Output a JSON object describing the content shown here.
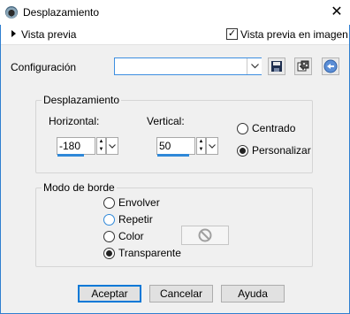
{
  "window": {
    "title": "Desplazamiento",
    "close_icon": "close-icon"
  },
  "preview": {
    "label": "Vista previa",
    "live_label": "Vista previa en imagen",
    "live_checked": true
  },
  "config": {
    "label": "Configuración",
    "value": ""
  },
  "offset_group": {
    "title": "Desplazamiento",
    "horizontal_label": "Horizontal:",
    "horizontal_value": "-180",
    "vertical_label": "Vertical:",
    "vertical_value": "50",
    "options": [
      {
        "label": "Centrado",
        "selected": false
      },
      {
        "label": "Personalizar",
        "selected": true
      }
    ]
  },
  "border_group": {
    "title": "Modo de borde",
    "options": [
      {
        "label": "Envolver",
        "selected": false
      },
      {
        "label": "Repetir",
        "selected": false
      },
      {
        "label": "Color",
        "selected": false
      },
      {
        "label": "Transparente",
        "selected": true
      }
    ]
  },
  "buttons": {
    "ok": "Aceptar",
    "cancel": "Cancelar",
    "help": "Ayuda"
  },
  "colors": {
    "accent": "#0078d7",
    "border_focus": "#3d8ee0"
  }
}
